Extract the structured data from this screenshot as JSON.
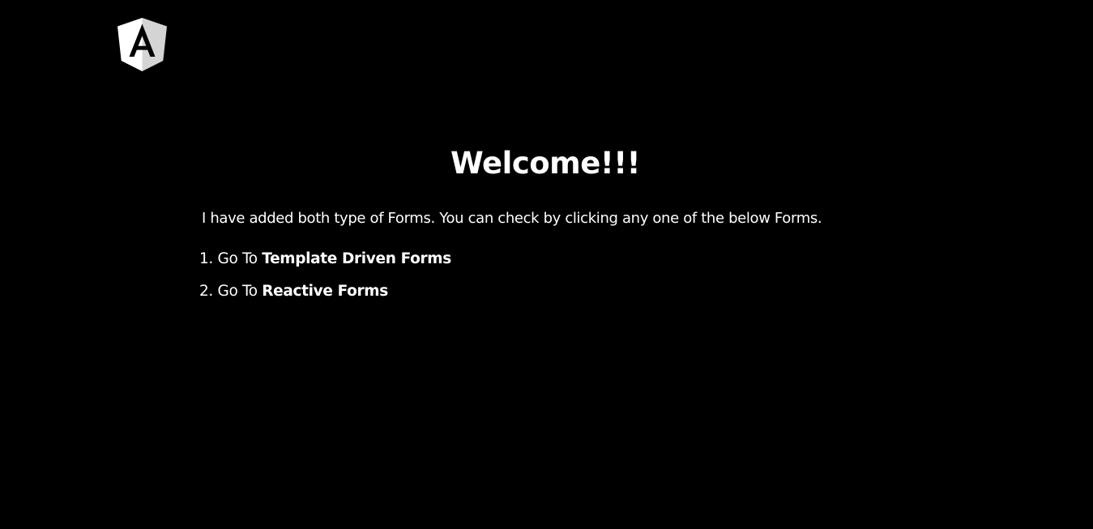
{
  "header": {
    "logo_icon": "angular-logo-icon",
    "logo_color": "#ffffff"
  },
  "main": {
    "title": "Welcome!!!",
    "intro": "I have added both type of Forms. You can check by clicking any one of the below Forms.",
    "links": [
      {
        "number": "1.",
        "prefix": "Go To",
        "label": "Template Driven Forms"
      },
      {
        "number": "2.",
        "prefix": "Go To",
        "label": "Reactive Forms"
      }
    ]
  },
  "colors": {
    "background": "#000000",
    "text": "#ffffff"
  }
}
